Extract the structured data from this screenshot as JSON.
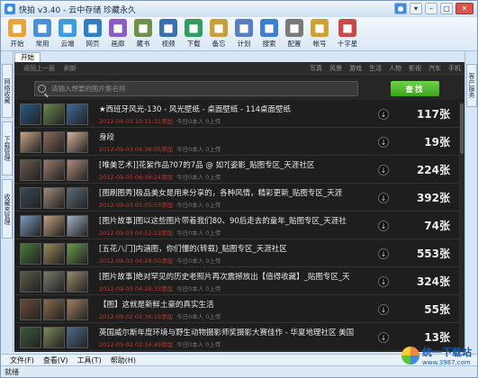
{
  "window": {
    "title": "快拍 v3.40 - 云中存储 珍藏永久"
  },
  "toolbar": [
    {
      "label": "开始",
      "color": "#e8a33a",
      "icon": "home-icon"
    },
    {
      "label": "常用",
      "color": "#4a8fd8",
      "icon": "star-icon"
    },
    {
      "label": "云端",
      "color": "#3a9de0",
      "icon": "cloud-icon"
    },
    {
      "label": "网页",
      "color": "#2f7fc8",
      "icon": "web-icon"
    },
    {
      "label": "画廊",
      "color": "#8a5bc8",
      "icon": "gallery-icon"
    },
    {
      "label": "藏书",
      "color": "#6f8f4a",
      "icon": "book-icon"
    },
    {
      "label": "视频",
      "color": "#3a6fb0",
      "icon": "video-icon"
    },
    {
      "label": "下载",
      "color": "#2f9f5f",
      "icon": "download-icon"
    },
    {
      "label": "备忘",
      "color": "#c8a03a",
      "icon": "memo-icon"
    },
    {
      "label": "计划",
      "color": "#5a7fc0",
      "icon": "calendar-icon"
    },
    {
      "label": "搜索",
      "color": "#3a7fd0",
      "icon": "search-icon"
    },
    {
      "label": "配置",
      "color": "#7a7a7a",
      "icon": "gear-icon"
    },
    {
      "label": "帐号",
      "color": "#d0a030",
      "icon": "account-icon"
    },
    {
      "label": "十字星",
      "color": "#c84a4a",
      "icon": "cross-star-icon"
    }
  ],
  "left_tabs": [
    "网络收藏",
    "下载管理",
    "收藏夹管理"
  ],
  "right_tabs": [
    "客户服务"
  ],
  "tab": {
    "label": "开始"
  },
  "nav": {
    "back": "返回上一层",
    "refresh": "刷新"
  },
  "categories": [
    "写真",
    "风景",
    "游戏",
    "生活",
    "人物",
    "影视",
    "汽车",
    "手机"
  ],
  "search": {
    "placeholder": "请输入想要的图片集名称",
    "button": "查找"
  },
  "rows": [
    {
      "title": "★西班牙风光-130 - 风光壁纸 - 桌面壁纸 - 114桌面壁纸",
      "date": "2012-09-03 10:11:31添加",
      "today": "今日0本人 0上传",
      "count": "117张",
      "thumbs": [
        "#2a5a8a",
        "#6a8a4a",
        "#3a6a9a"
      ]
    },
    {
      "title": "身段",
      "date": "2012-09-03 08:38:05添加",
      "today": "今日0本人 0上传",
      "count": "19张",
      "thumbs": [
        "#c8a48a",
        "#8a6a5a",
        "#d4b09a"
      ]
    },
    {
      "title": "[唯美艺术]]花絮作品?07的7品 @ 如?[姿影_贴图专区_天涯社区",
      "date": "2012-09-03 06:38:24添加",
      "today": "今日0本人 0上传",
      "count": "224张",
      "thumbs": [
        "#6a5a4a",
        "#9a7a6a",
        "#b08a7a"
      ]
    },
    {
      "title": "[图刷图秀]极品美女是用来分享的，各种风情，精彩更新_贴图专区_天涯",
      "date": "2012-09-03 05:05:03添加",
      "today": "今日0本人 0上传",
      "count": "392张",
      "thumbs": [
        "#3a4a5a",
        "#a08a7a",
        "#5a6a7a"
      ]
    },
    {
      "title": "[图片故事]图以这些图片带着我们80、90后走去的童年_贴图专区_天涯社",
      "date": "2012-09-03 04:52:13添加",
      "today": "今日0本人 0上传",
      "count": "74张",
      "thumbs": [
        "#7a9ac0",
        "#c0a080",
        "#a0b0c0"
      ]
    },
    {
      "title": "[五花八门]内涵图，你们懂的(转载)_贴图专区_天涯社区",
      "date": "2012-09-03 04:28:50添加",
      "today": "今日0本人 0上传",
      "count": "553张",
      "thumbs": [
        "#4a7a3a",
        "#9a8a5a",
        "#6a9a4a"
      ]
    },
    {
      "title": "[图片故事]绝对罕见的历史老照片再次震撼放出【值得收藏】_贴图专区_天",
      "date": "2012-09-03 04:28:33添加",
      "today": "今日0本人 0上传",
      "count": "324张",
      "thumbs": [
        "#5a5a4a",
        "#7a7a6a",
        "#9a8a6a"
      ]
    },
    {
      "title": "【图】这就是新鲜土豪的真实生活",
      "date": "2012-09-02 02:36:19添加",
      "today": "今日0本人 0上传",
      "count": "55张",
      "thumbs": [
        "#6a4a3a",
        "#8a6a4a",
        "#a08060"
      ]
    },
    {
      "title": "英国威尔斯年度环境与野生动物摄影师奖摄影大赛佳作 - 华夏地理社区 美国",
      "date": "2012-09-02 02:34:49添加",
      "today": "今日0本人 0上传",
      "count": "13张",
      "thumbs": [
        "#3a5a3a",
        "#7a8a5a",
        "#4a6a8a"
      ]
    }
  ],
  "menu": [
    "文件(F)",
    "查看(V)",
    "工具(T)",
    "帮助(H)"
  ],
  "status": {
    "text": "就绪"
  },
  "watermark": {
    "name": "统一下载站",
    "url": "www.3987.com"
  }
}
